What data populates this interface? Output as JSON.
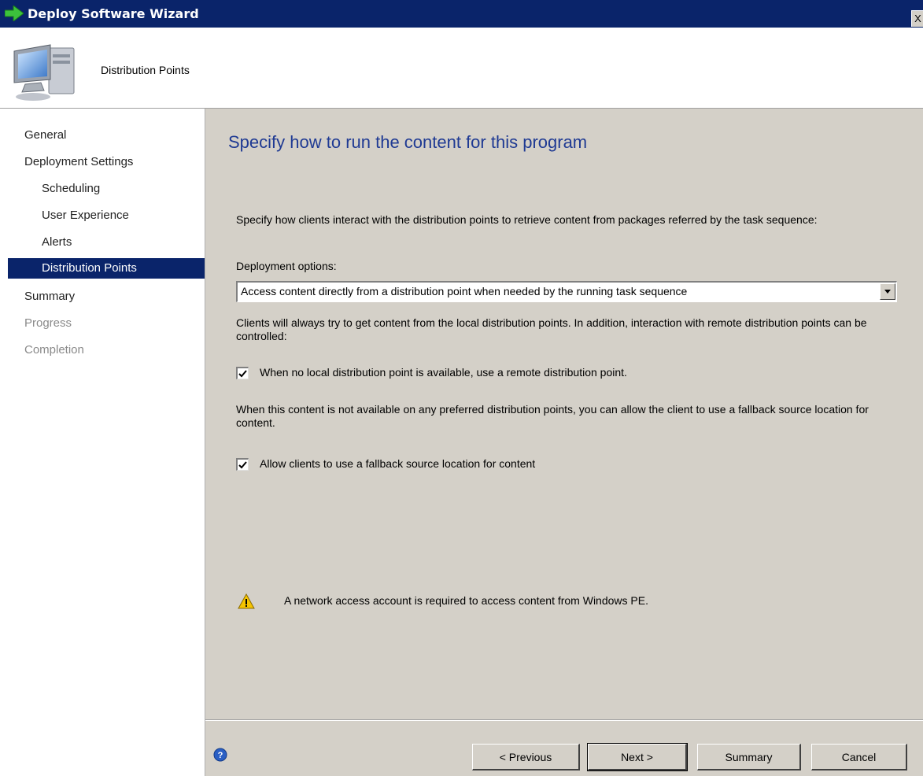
{
  "window": {
    "title": "Deploy Software Wizard",
    "close_glyph": "X"
  },
  "header": {
    "page_name": "Distribution Points",
    "icon": "computer-icon"
  },
  "sidebar": {
    "items": [
      {
        "label": "General",
        "level": 0,
        "state": "normal"
      },
      {
        "label": "Deployment Settings",
        "level": 0,
        "state": "normal"
      },
      {
        "label": "Scheduling",
        "level": 1,
        "state": "normal"
      },
      {
        "label": "User Experience",
        "level": 1,
        "state": "normal"
      },
      {
        "label": "Alerts",
        "level": 1,
        "state": "normal"
      },
      {
        "label": "Distribution Points",
        "level": 1,
        "state": "selected"
      },
      {
        "label": "Summary",
        "level": 0,
        "state": "normal"
      },
      {
        "label": "Progress",
        "level": 0,
        "state": "disabled"
      },
      {
        "label": "Completion",
        "level": 0,
        "state": "disabled"
      }
    ]
  },
  "main": {
    "heading": "Specify how to run the content for this program",
    "intro": "Specify how clients interact with the distribution points to retrieve content from packages referred by the task sequence:",
    "deployment_options_label": "Deployment options:",
    "deployment_option_selected": "Access content directly from a distribution point when needed by the running task sequence",
    "local_dp_text": "Clients will always try to get content from the local distribution points. In addition, interaction with remote distribution points can be controlled:",
    "remote_dp_checkbox": {
      "label": "When no local distribution point is available, use a remote distribution point.",
      "checked": true
    },
    "fallback_text": "When this content is not available on any preferred distribution points, you can allow the client to use a fallback source location for content.",
    "fallback_checkbox": {
      "label": "Allow clients to use a fallback source location for content",
      "checked": true
    },
    "warning": "A network access account is required to access content from Windows PE."
  },
  "buttons": {
    "previous": "< Previous",
    "next": "Next >",
    "summary": "Summary",
    "cancel": "Cancel"
  },
  "colors": {
    "titlebar": "#0a246a",
    "selection": "#0a246a",
    "heading": "#1f3a93",
    "window_bg": "#d4d0c8",
    "warning": "#f5c400"
  }
}
